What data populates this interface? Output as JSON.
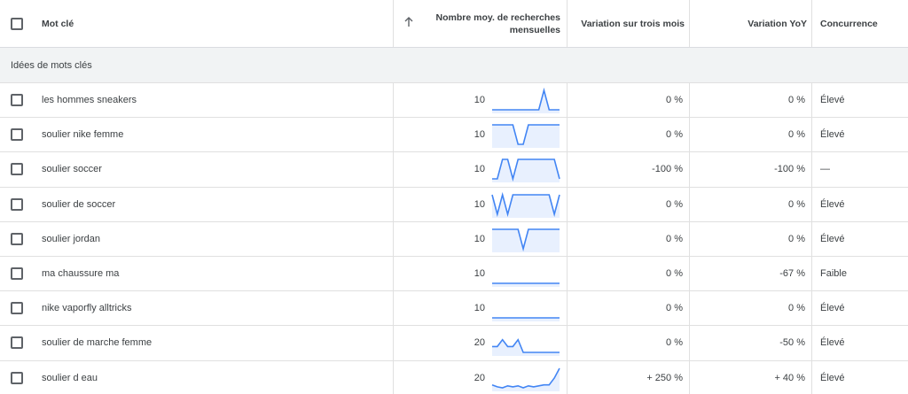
{
  "header": {
    "keyword": "Mot clé",
    "avg_searches": "Nombre moy. de recherches",
    "avg_searches_2": "mensuelles",
    "three_month": "Variation sur trois mois",
    "yoy": "Variation YoY",
    "competition": "Concurrence",
    "sort_icon": "arrow-up-icon"
  },
  "group": {
    "label": "Idées de mots clés"
  },
  "rows": [
    {
      "keyword": "les hommes sneakers",
      "avg": "10",
      "three_month": "0 %",
      "yoy": "0 %",
      "competition": "Élevé",
      "trend": [
        0,
        0,
        0,
        0,
        0,
        0,
        0,
        0,
        0,
        0,
        1,
        0,
        0,
        0
      ]
    },
    {
      "keyword": "soulier nike femme",
      "avg": "10",
      "three_month": "0 %",
      "yoy": "0 %",
      "competition": "Élevé",
      "trend": [
        1,
        1,
        1,
        1,
        1,
        0,
        0,
        1,
        1,
        1,
        1,
        1,
        1,
        1
      ]
    },
    {
      "keyword": "soulier soccer",
      "avg": "10",
      "three_month": "-100 %",
      "yoy": "-100 %",
      "competition": "—",
      "trend": [
        0,
        0,
        1,
        1,
        0,
        1,
        1,
        1,
        1,
        1,
        1,
        1,
        1,
        0
      ]
    },
    {
      "keyword": "soulier de soccer",
      "avg": "10",
      "three_month": "0 %",
      "yoy": "0 %",
      "competition": "Élevé",
      "trend": [
        1,
        0,
        1,
        0,
        1,
        1,
        1,
        1,
        1,
        1,
        1,
        1,
        0,
        1
      ]
    },
    {
      "keyword": "soulier jordan",
      "avg": "10",
      "three_month": "0 %",
      "yoy": "0 %",
      "competition": "Élevé",
      "trend": [
        1,
        1,
        1,
        1,
        1,
        1,
        0,
        1,
        1,
        1,
        1,
        1,
        1,
        1
      ]
    },
    {
      "keyword": "ma chaussure ma",
      "avg": "10",
      "three_month": "0 %",
      "yoy": "-67 %",
      "competition": "Faible",
      "trend": [
        0,
        0,
        0,
        0,
        0,
        0,
        0,
        0,
        0,
        0,
        0,
        0,
        0,
        0
      ]
    },
    {
      "keyword": "nike vaporfly alltricks",
      "avg": "10",
      "three_month": "0 %",
      "yoy": "0 %",
      "competition": "Élevé",
      "trend": [
        0,
        0,
        0,
        0,
        0,
        0,
        0,
        0,
        0,
        0,
        0,
        0,
        0,
        0
      ]
    },
    {
      "keyword": "soulier de marche femme",
      "avg": "20",
      "three_month": "0 %",
      "yoy": "-50 %",
      "competition": "Élevé",
      "trend": [
        0.3,
        0.3,
        0.65,
        0.3,
        0.3,
        0.65,
        0,
        0,
        0,
        0,
        0,
        0,
        0,
        0
      ]
    },
    {
      "keyword": "soulier d eau",
      "avg": "20",
      "three_month": "+ 250 %",
      "yoy": "+ 40 %",
      "competition": "Élevé",
      "trend": [
        0.15,
        0.05,
        0,
        0.1,
        0.05,
        0.1,
        0,
        0.1,
        0.05,
        0.1,
        0.15,
        0.15,
        0.5,
        1
      ]
    }
  ],
  "colors": {
    "accent": "#4285f4",
    "fill": "#e8f0fe",
    "grid": "#e0e0e0"
  }
}
